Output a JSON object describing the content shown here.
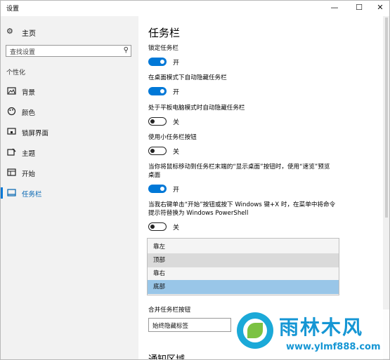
{
  "window": {
    "title": "设置",
    "controls": {
      "minimize": "—",
      "maximize": "☐",
      "close": "✕"
    }
  },
  "sidebar": {
    "home_label": "主页",
    "search_placeholder": "查找设置",
    "section_label": "个性化",
    "items": [
      {
        "label": "背景",
        "icon": "image-icon"
      },
      {
        "label": "颜色",
        "icon": "palette-icon"
      },
      {
        "label": "锁屏界面",
        "icon": "lock-screen-icon"
      },
      {
        "label": "主题",
        "icon": "brush-icon"
      },
      {
        "label": "开始",
        "icon": "start-icon"
      },
      {
        "label": "任务栏",
        "icon": "taskbar-icon",
        "active": true
      }
    ]
  },
  "main": {
    "title": "任务栏",
    "settings": [
      {
        "label": "锁定任务栏",
        "state": "开",
        "on": true
      },
      {
        "label": "在桌面模式下自动隐藏任务栏",
        "state": "开",
        "on": true
      },
      {
        "label": "处于平板电脑模式时自动隐藏任务栏",
        "state": "关",
        "on": false
      },
      {
        "label": "使用小任务栏按钮",
        "state": "关",
        "on": false
      },
      {
        "label": "当你将鼠标移动到任务栏末端的“显示桌面”按钮时，使用“速览”预览桌面",
        "state": "开",
        "on": true
      },
      {
        "label": "当我右键单击“开始”按钮或按下 Windows 键+X 时，在菜单中将命令提示符替换为 Windows PowerShell",
        "state": "关",
        "on": false
      }
    ],
    "position_options": [
      "靠左",
      "顶部",
      "靠右",
      "底部"
    ],
    "position_selected": "底部",
    "combine_label": "合并任务栏按钮",
    "combine_value": "始终隐藏标签",
    "next_section": "通知区域"
  },
  "watermark": {
    "name": "雨林木风",
    "url": "www.ylmf888.com"
  },
  "colors": {
    "accent": "#0078d7",
    "selected_option": "#99c6e8",
    "sidebar_bg": "#f2f2f2"
  }
}
